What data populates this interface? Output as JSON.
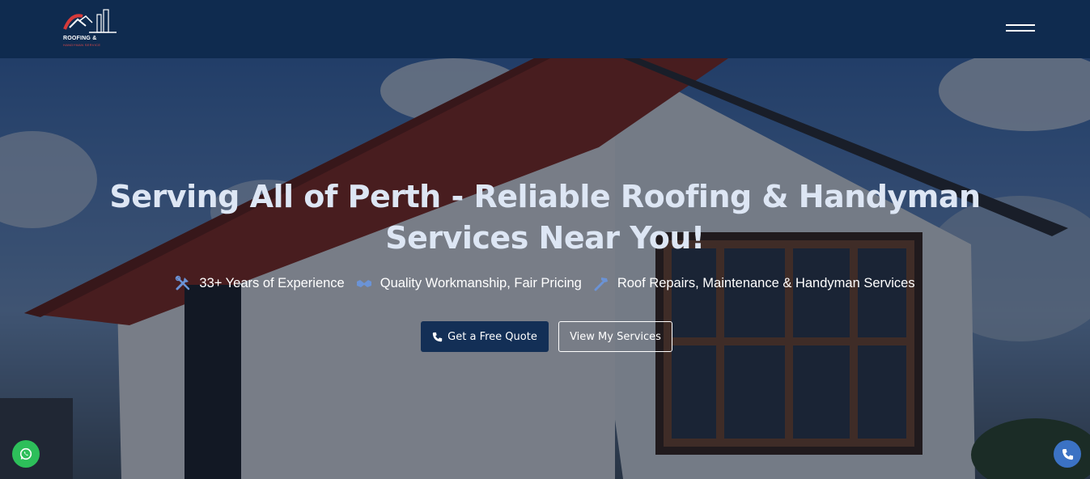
{
  "header": {
    "logo": {
      "brand": "ROOFING &",
      "tagline": "HANDYMAN SERVICE"
    },
    "menu_icon": "hamburger-menu-icon"
  },
  "hero": {
    "headline": "Serving All of Perth - Reliable Roofing & Handyman Services Near You!",
    "features": [
      {
        "icon": "tools-icon",
        "label": "33+ Years of Experience"
      },
      {
        "icon": "handshake-icon",
        "label": "Quality Workmanship, Fair Pricing"
      },
      {
        "icon": "hammer-icon",
        "label": "Roof Repairs, Maintenance & Handyman Services"
      }
    ],
    "buttons": {
      "quote": {
        "label": "Get a Free Quote",
        "icon": "phone-icon"
      },
      "services": {
        "label": "View My Services"
      }
    }
  },
  "floating": {
    "whatsapp_icon": "whatsapp-icon",
    "phone_icon": "phone-icon"
  },
  "colors": {
    "header_bg": "#0f2b4f",
    "primary_button": "#132f56",
    "whatsapp": "#2dbf5a",
    "phone_fab": "#3b72c4",
    "feature_icon": "#6b93d6"
  }
}
